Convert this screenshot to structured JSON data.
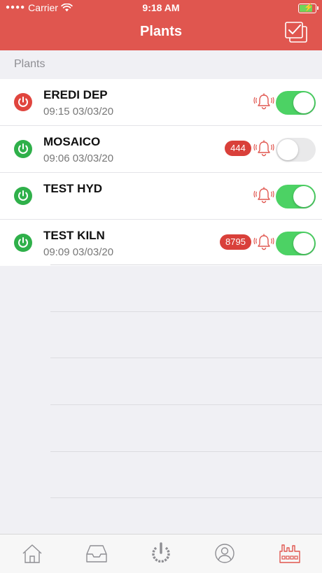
{
  "status_bar": {
    "carrier": "Carrier",
    "time": "9:18 AM",
    "signal_dots": "●●●●",
    "wifi_icon": "wifi-icon",
    "battery_icon": "battery-charging-icon"
  },
  "nav": {
    "title": "Plants",
    "action_icon": "select-all-checkbox-icon"
  },
  "section": {
    "header": "Plants"
  },
  "plants": [
    {
      "name": "EREDI DEP",
      "time": "09:15 03/03/20",
      "status_color": "#e0453e",
      "badge": "",
      "alarm_enabled": true
    },
    {
      "name": "MOSAICO",
      "time": "09:06 03/03/20",
      "status_color": "#2fb04a",
      "badge": "444",
      "alarm_enabled": false
    },
    {
      "name": "TEST HYD",
      "time": "",
      "status_color": "#2fb04a",
      "badge": "",
      "alarm_enabled": true
    },
    {
      "name": "TEST KILN",
      "time": "09:09 03/03/20",
      "status_color": "#2fb04a",
      "badge": "8795",
      "alarm_enabled": true
    }
  ],
  "tabs": [
    {
      "icon": "home-icon",
      "active": false
    },
    {
      "icon": "inbox-icon",
      "active": false
    },
    {
      "icon": "power-icon",
      "active": false
    },
    {
      "icon": "user-icon",
      "active": false
    },
    {
      "icon": "factory-icon",
      "active": true
    }
  ],
  "colors": {
    "accent": "#e0564f",
    "status_on": "#2fb04a",
    "status_alarm": "#e0453e",
    "toggle_on": "#4cd264",
    "badge": "#d9403a"
  }
}
